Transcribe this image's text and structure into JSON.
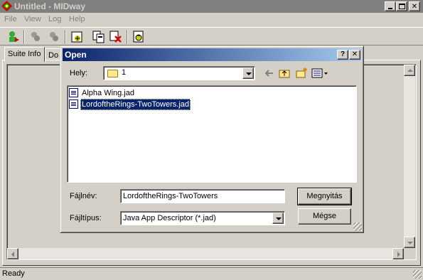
{
  "main_window": {
    "title": "Untitled - MIDway",
    "caption_buttons": [
      "minimize",
      "maximize",
      "close"
    ]
  },
  "menu": {
    "items": [
      "File",
      "View",
      "Log",
      "Help"
    ]
  },
  "toolbar": {
    "icons": [
      "open-suite-icon",
      "tool-gray-icon-1",
      "tool-gray-icon-2",
      "install-icon",
      "copy-icon",
      "delete-icon",
      "run-icon"
    ]
  },
  "tabs": [
    {
      "label": "Suite Info",
      "active": true
    },
    {
      "label": "Do",
      "active": false
    }
  ],
  "status_bar": {
    "text": "Ready"
  },
  "open_dialog": {
    "title": "Open",
    "help_glyph": "?",
    "close_glyph": "✕",
    "look_in_label": "Hely:",
    "look_in_value": "1",
    "files": [
      {
        "name": "Alpha Wing.jad",
        "selected": false
      },
      {
        "name": "LordoftheRings-TwoTowers.jad",
        "selected": true
      }
    ],
    "filename_label": "Fájlnév:",
    "filename_value": "LordoftheRings-TwoTowers",
    "filetype_label": "Fájltípus:",
    "filetype_value": "Java App Descriptor (*.jad)",
    "open_button": "Megnyitás",
    "cancel_button": "Mégse"
  },
  "colors": {
    "dialog_title_start": "#0a246a",
    "dialog_title_end": "#a6caf0",
    "inactive_title": "#808080",
    "selection": "#0a246a"
  }
}
